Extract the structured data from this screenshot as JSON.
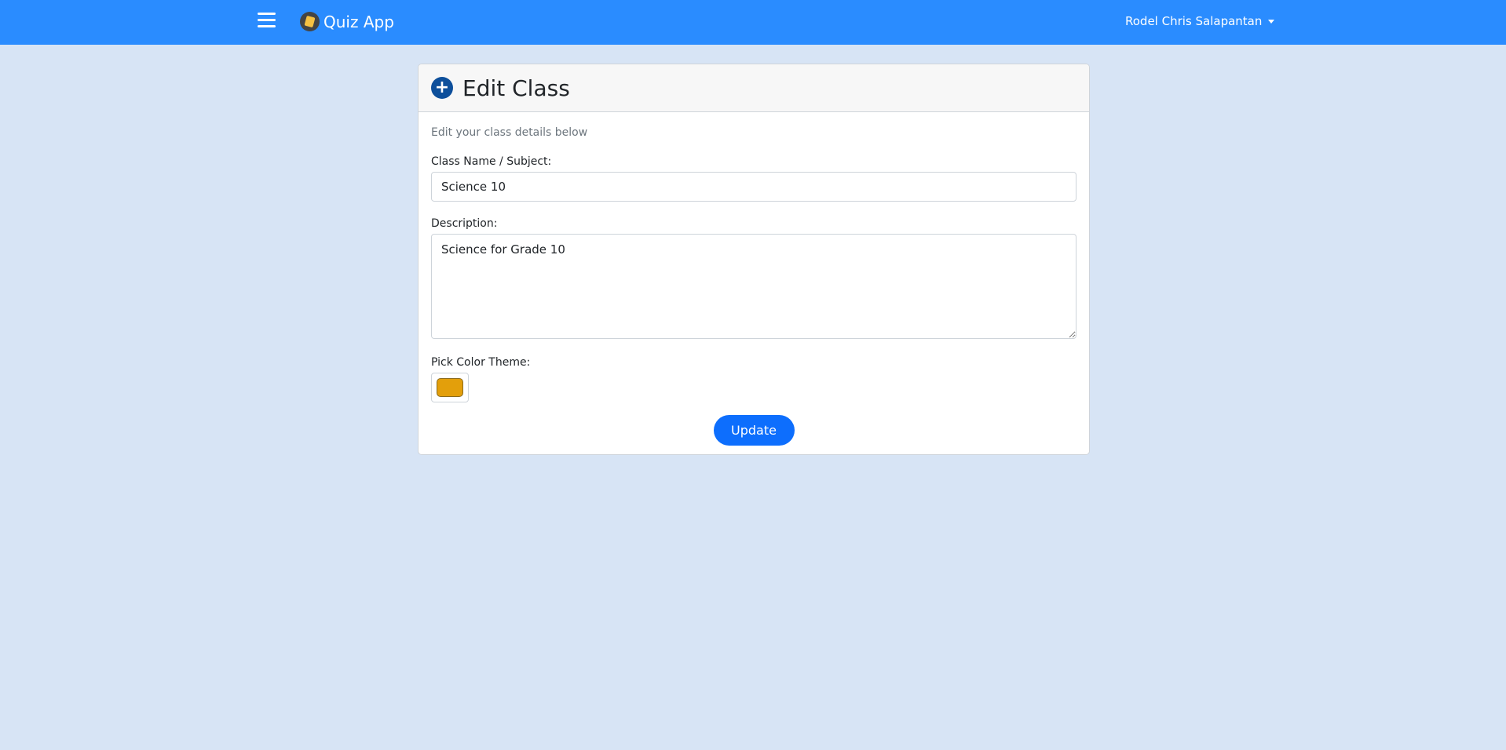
{
  "navbar": {
    "brand": "Quiz App",
    "user_name": "Rodel Chris Salapantan"
  },
  "card": {
    "title": "Edit Class",
    "subtitle": "Edit your class details below",
    "class_name_label": "Class Name / Subject:",
    "class_name_value": "Science 10",
    "description_label": "Description:",
    "description_value": "Science for Grade 10",
    "color_label": "Pick Color Theme:",
    "color_value": "#e39f0b",
    "update_label": "Update"
  },
  "colors": {
    "navbar_bg": "#2a8cff",
    "page_bg": "#d7e4f5",
    "primary_button": "#0d6efd",
    "header_icon": "#0d4f9b"
  }
}
